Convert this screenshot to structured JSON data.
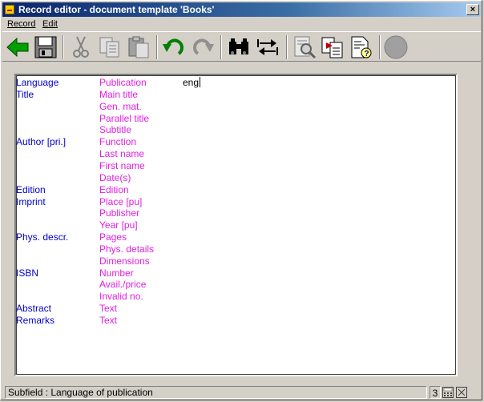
{
  "window": {
    "title": "Record editor - document template 'Books'",
    "close_label": "×"
  },
  "menu": {
    "items": [
      {
        "label": "Record"
      },
      {
        "label": "Edit"
      }
    ]
  },
  "toolbar": {
    "buttons": [
      {
        "icon": "back-arrow-icon"
      },
      {
        "icon": "save-icon"
      },
      {
        "icon": "cut-icon"
      },
      {
        "icon": "copy-icon"
      },
      {
        "icon": "paste-icon"
      },
      {
        "icon": "undo-icon"
      },
      {
        "icon": "redo-icon"
      },
      {
        "icon": "find-icon"
      },
      {
        "icon": "swap-icon"
      },
      {
        "icon": "search-document-icon"
      },
      {
        "icon": "copy-template-icon"
      },
      {
        "icon": "document-help-icon"
      },
      {
        "icon": "stop-circle-icon"
      }
    ]
  },
  "record": {
    "rows": [
      {
        "field": "Language",
        "subfield": "Publication",
        "value": "eng"
      },
      {
        "field": "Title",
        "subfield": "Main title",
        "value": ""
      },
      {
        "field": "",
        "subfield": "Gen. mat.",
        "value": ""
      },
      {
        "field": "",
        "subfield": "Parallel title",
        "value": ""
      },
      {
        "field": "",
        "subfield": "Subtitle",
        "value": ""
      },
      {
        "field": "Author [pri.]",
        "subfield": "Function",
        "value": ""
      },
      {
        "field": "",
        "subfield": "Last name",
        "value": ""
      },
      {
        "field": "",
        "subfield": "First name",
        "value": ""
      },
      {
        "field": "",
        "subfield": "Date(s)",
        "value": ""
      },
      {
        "field": "Edition",
        "subfield": "Edition",
        "value": ""
      },
      {
        "field": "Imprint",
        "subfield": "Place [pu]",
        "value": ""
      },
      {
        "field": "",
        "subfield": "Publisher",
        "value": ""
      },
      {
        "field": "",
        "subfield": "Year [pu]",
        "value": ""
      },
      {
        "field": "Phys. descr.",
        "subfield": "Pages",
        "value": ""
      },
      {
        "field": "",
        "subfield": "Phys. details",
        "value": ""
      },
      {
        "field": "",
        "subfield": "Dimensions",
        "value": ""
      },
      {
        "field": "ISBN",
        "subfield": "Number",
        "value": ""
      },
      {
        "field": "",
        "subfield": "Avail./price",
        "value": ""
      },
      {
        "field": "",
        "subfield": "Invalid no.",
        "value": ""
      },
      {
        "field": "Abstract",
        "subfield": "Text",
        "value": ""
      },
      {
        "field": "Remarks",
        "subfield": "Text",
        "value": ""
      }
    ]
  },
  "status": {
    "text": "Subfield : Language of publication",
    "number": "3"
  },
  "colors": {
    "field_label": "#0000cc",
    "subfield_label": "#e020e0",
    "titlebar": "#0a246a"
  }
}
